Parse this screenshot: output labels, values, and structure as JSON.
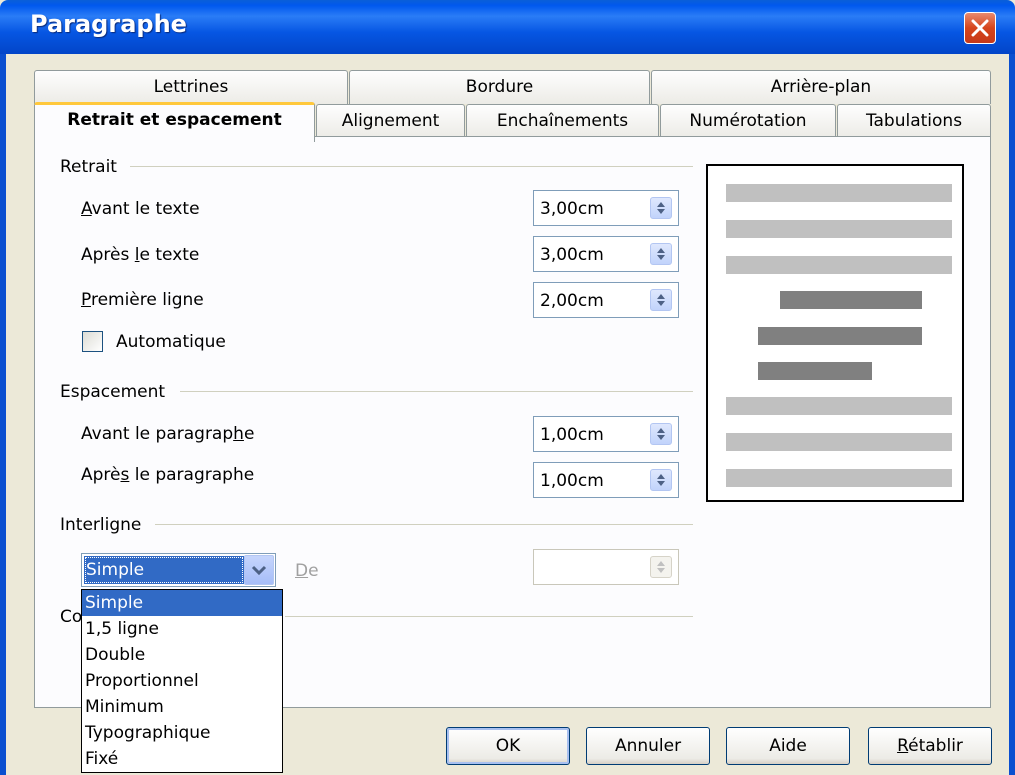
{
  "window": {
    "title": "Paragraphe"
  },
  "tabs_row1": [
    {
      "label": "Lettrines"
    },
    {
      "label": "Bordure"
    },
    {
      "label": "Arrière-plan"
    }
  ],
  "tabs_row2": [
    {
      "label": "Retrait et espacement"
    },
    {
      "label": "Alignement"
    },
    {
      "label": "Enchaînements"
    },
    {
      "label": "Numérotation"
    },
    {
      "label": "Tabulations"
    }
  ],
  "retrait": {
    "heading": "Retrait",
    "avant": {
      "label_u": "A",
      "label_rest": "vant le texte",
      "value": "3,00cm"
    },
    "apres": {
      "label_a": "Après ",
      "label_u": "l",
      "label_b": "e texte",
      "value": "3,00cm"
    },
    "premiere": {
      "label_u": "P",
      "label_rest": "remière ligne",
      "value": "2,00cm"
    },
    "auto": {
      "label": "Automatique"
    }
  },
  "espacement": {
    "heading": "Espacement",
    "avant": {
      "label_a": "Avant le paragrap",
      "label_u": "h",
      "label_b": "e",
      "value": "1,00cm"
    },
    "apres": {
      "label_a": "Aprè",
      "label_u": "s",
      "label_b": " le paragraphe",
      "value": "1,00cm"
    }
  },
  "interligne": {
    "heading": "Interligne",
    "selected": "Simple",
    "de_u": "D",
    "de_rest": "e",
    "de_value": "",
    "options": [
      "Simple",
      "1,5 ligne",
      "Double",
      "Proportionnel",
      "Minimum",
      "Typographique",
      "Fixé"
    ]
  },
  "hidden_section": {
    "heading_partial": "Co"
  },
  "buttons": {
    "ok": "OK",
    "annuler": "Annuler",
    "aide": "Aide",
    "retablir_u": "R",
    "retablir_rest": "établir"
  },
  "colors": {
    "title_bar": "#0058ee",
    "selection": "#316ac5",
    "active_tab_accent": "#ffc83c"
  }
}
